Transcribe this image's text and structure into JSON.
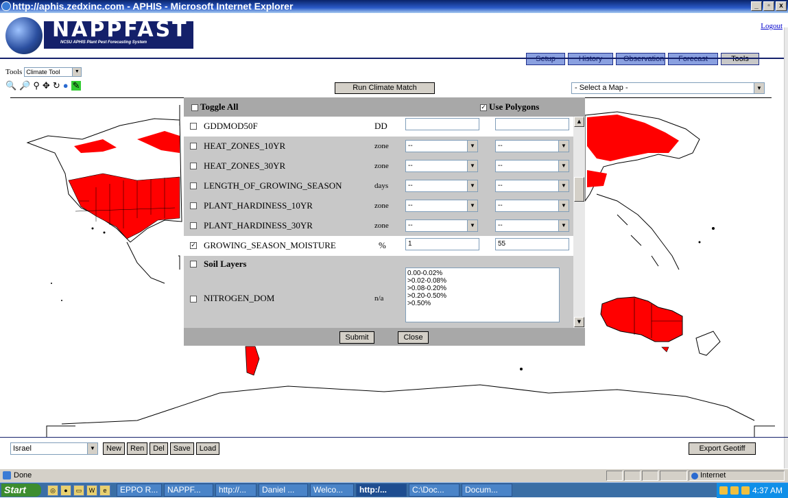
{
  "window": {
    "title": "http://aphis.zedxinc.com - APHIS - Microsoft Internet Explorer",
    "controls": [
      "_",
      "И",
      "x"
    ]
  },
  "header": {
    "logo_title": "NAPPFAST",
    "logo_subtitle": "NCSU APHIS Plant Pest Forecasting System",
    "logout_label": "Logout",
    "nav": [
      {
        "label": "Setup"
      },
      {
        "label": "History"
      },
      {
        "label": "Observation"
      },
      {
        "label": "Forecast"
      },
      {
        "label": "Tools"
      }
    ]
  },
  "toolbar": {
    "tools_label": "Tools",
    "tool_select_value": "Climate Tool",
    "run_button": "Run Climate Match",
    "map_select_value": "- Select a Map -"
  },
  "panel": {
    "toggle_all_label": "Toggle All",
    "use_polygons_label": "Use Polygons",
    "use_polygons_checked": true,
    "rows": [
      {
        "name": "GDDMOD50F",
        "unit": "DD",
        "low": "",
        "high": "",
        "checked": false,
        "kind": "text"
      },
      {
        "name": "HEAT_ZONES_10YR",
        "unit": "zone",
        "low": "--",
        "high": "--",
        "checked": false,
        "kind": "select"
      },
      {
        "name": "HEAT_ZONES_30YR",
        "unit": "zone",
        "low": "--",
        "high": "--",
        "checked": false,
        "kind": "select"
      },
      {
        "name": "LENGTH_OF_GROWING_SEASON",
        "unit": "days",
        "low": "--",
        "high": "--",
        "checked": false,
        "kind": "select"
      },
      {
        "name": "PLANT_HARDINESS_10YR",
        "unit": "zone",
        "low": "--",
        "high": "--",
        "checked": false,
        "kind": "select"
      },
      {
        "name": "PLANT_HARDINESS_30YR",
        "unit": "zone",
        "low": "--",
        "high": "--",
        "checked": false,
        "kind": "select"
      },
      {
        "name": "GROWING_SEASON_MOISTURE",
        "unit": "%",
        "low": "1",
        "high": "55",
        "checked": true,
        "kind": "text"
      }
    ],
    "section_soil": "Soil Layers",
    "nitrogen": {
      "name": "NITROGEN_DOM",
      "unit": "n/a",
      "options": [
        "0.00-0.02%",
        ">0.02-0.08%",
        ">0.08-0.20%",
        ">0.20-0.50%",
        ">0.50%"
      ]
    },
    "submit_label": "Submit",
    "close_label": "Close"
  },
  "bottom": {
    "country_value": "Israel",
    "buttons": [
      "New",
      "Ren",
      "Del",
      "Save",
      "Load"
    ],
    "export_label": "Export Geotiff"
  },
  "status": {
    "text": "Done",
    "zone": "Internet"
  },
  "taskbar": {
    "start_label": "Start",
    "tasks": [
      "EPPO R...",
      "NAPPF...",
      "http://...",
      "Daniel ...",
      "Welco...",
      "http:/...",
      "C:\\Doc...",
      "Docum..."
    ],
    "active_task_index": 5,
    "clock": "4:37 AM"
  },
  "colors": {
    "brand_navy": "#14206a",
    "nav_button": "#8aa0e0",
    "map_highlight": "#ff0000"
  }
}
